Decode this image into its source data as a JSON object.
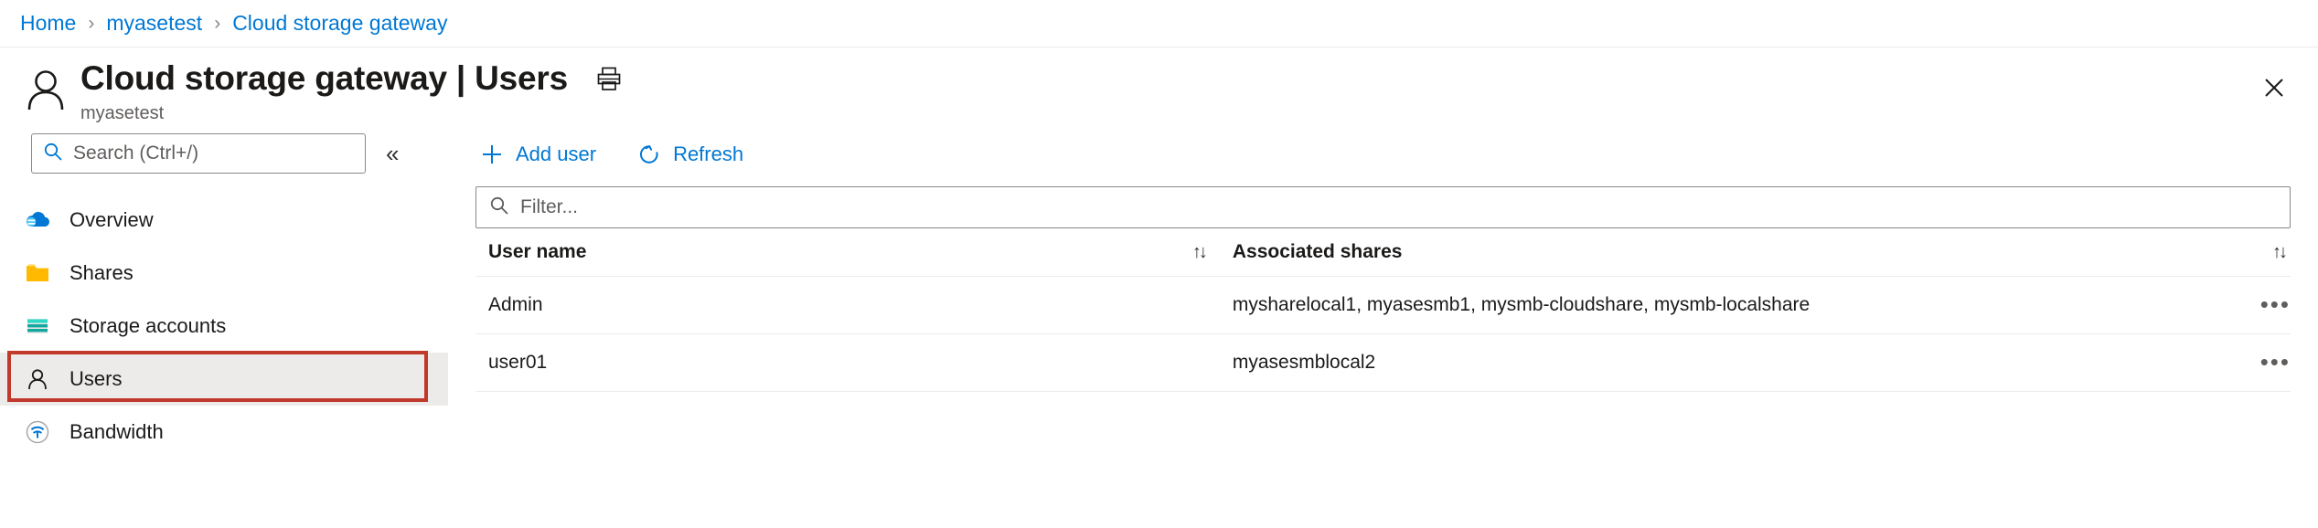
{
  "breadcrumb": {
    "items": [
      {
        "label": "Home"
      },
      {
        "label": "myasetest"
      },
      {
        "label": "Cloud storage gateway"
      }
    ],
    "separator": "›"
  },
  "header": {
    "title": "Cloud storage gateway | Users",
    "subtitle": "myasetest",
    "icon": "user-outline-icon",
    "print_icon": "printer-icon",
    "close_icon": "close-icon"
  },
  "sidebar": {
    "search": {
      "placeholder": "Search (Ctrl+/)",
      "value": "",
      "icon": "search-icon"
    },
    "collapse_glyph": "«",
    "items": [
      {
        "label": "Overview",
        "icon": "cloud-icon",
        "selected": false
      },
      {
        "label": "Shares",
        "icon": "folder-icon",
        "selected": false
      },
      {
        "label": "Storage accounts",
        "icon": "storage-account-icon",
        "selected": false
      },
      {
        "label": "Users",
        "icon": "user-icon",
        "selected": true
      },
      {
        "label": "Bandwidth",
        "icon": "bandwidth-icon",
        "selected": false
      }
    ],
    "highlight_color": "#c0392b"
  },
  "toolbar": {
    "add_user_label": "Add user",
    "add_user_icon": "plus-icon",
    "refresh_label": "Refresh",
    "refresh_icon": "refresh-icon"
  },
  "filter": {
    "placeholder": "Filter...",
    "value": "",
    "icon": "search-icon"
  },
  "table": {
    "columns": [
      {
        "label": "User name",
        "sort_icon": "sort-updown-icon"
      },
      {
        "label": "Associated shares",
        "sort_icon": "sort-updown-icon"
      }
    ],
    "sort_glyph": "↑↓",
    "ellipsis_glyph": "•••",
    "rows": [
      {
        "user_name": "Admin",
        "associated_shares": "mysharelocal1, myasesmb1, mysmb-cloudshare, mysmb-localshare"
      },
      {
        "user_name": "user01",
        "associated_shares": "myasesmblocal2"
      }
    ]
  },
  "colors": {
    "accent": "#0078d4",
    "selected_bg": "#edebe9",
    "annotation": "#c0392b"
  }
}
